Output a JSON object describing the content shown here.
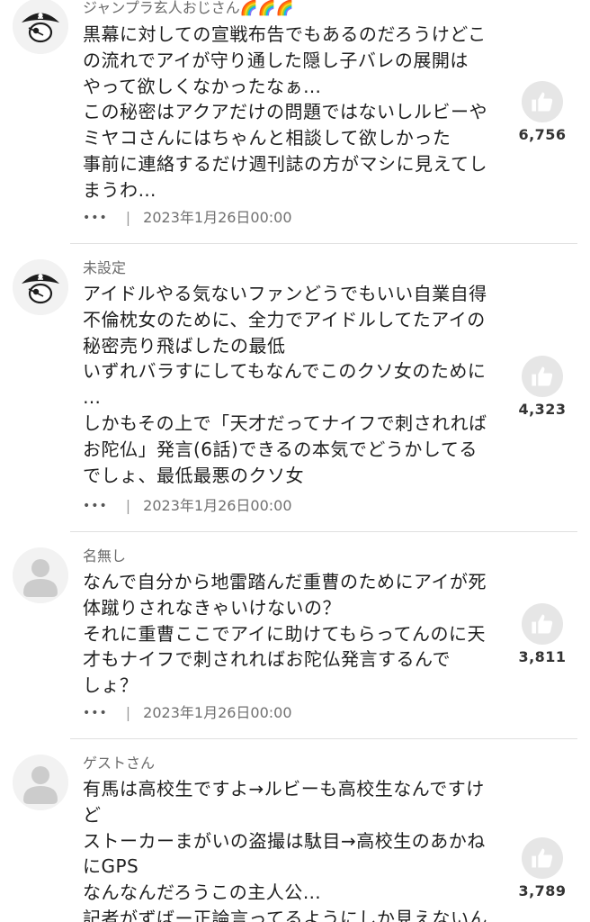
{
  "comments": [
    {
      "author": "ジャンプラ玄人おじさん🌈🌈🌈",
      "avatar": "pirate-avatar-icon",
      "lines": [
        "黒幕に対しての宣戦布告でもあるのだろうけどこ",
        "の流れでアイが守り通した隠し子バレの展開は",
        "やって欲しくなかったなぁ…",
        "この秘密はアクアだけの問題ではないしルビーや",
        "ミヤコさんにはちゃんと相談して欲しかった",
        "事前に連絡するだけ週刊誌の方がマシに見えてし",
        "まうわ…"
      ],
      "more": "•••",
      "separator": "|",
      "timestamp": "2023年1月26日00:00",
      "likes": "6,756"
    },
    {
      "author": "未設定",
      "avatar": "pirate-avatar-icon",
      "lines": [
        "アイドルやる気ないファンどうでもいい自業自得",
        "不倫枕女のために、全力でアイドルしてたアイの",
        "秘密売り飛ばしたの最低",
        "いずれバラすにしてもなんでこのクソ女のために",
        "…",
        "しかもその上で「天才だってナイフで刺されれば",
        "お陀仏」発言(6話)できるの本気でどうかしてる",
        "でしょ、最低最悪のクソ女"
      ],
      "more": "•••",
      "separator": "|",
      "timestamp": "2023年1月26日00:00",
      "likes": "4,323"
    },
    {
      "author": "名無し",
      "avatar": "default-user-avatar-icon",
      "lines": [
        "なんで自分から地雷踏んだ重曹のためにアイが死",
        "体蹴りされなきゃいけないの？",
        "それに重曹ここでアイに助けてもらってんのに天",
        "才もナイフで刺されればお陀仏発言するんで",
        "しょ？"
      ],
      "more": "•••",
      "separator": "|",
      "timestamp": "2023年1月26日00:00",
      "likes": "3,811"
    },
    {
      "author": "ゲストさん",
      "avatar": "default-user-avatar-icon",
      "lines": [
        "有馬は高校生ですよ→ルビーも高校生なんですけ",
        "ど",
        "ストーカーまがいの盗撮は駄目→高校生のあかね",
        "にGPS",
        "なんなんだろうこの主人公…",
        "記者がずばー正論言ってるようにしか見えないん"
      ],
      "likes": "3,789"
    }
  ]
}
